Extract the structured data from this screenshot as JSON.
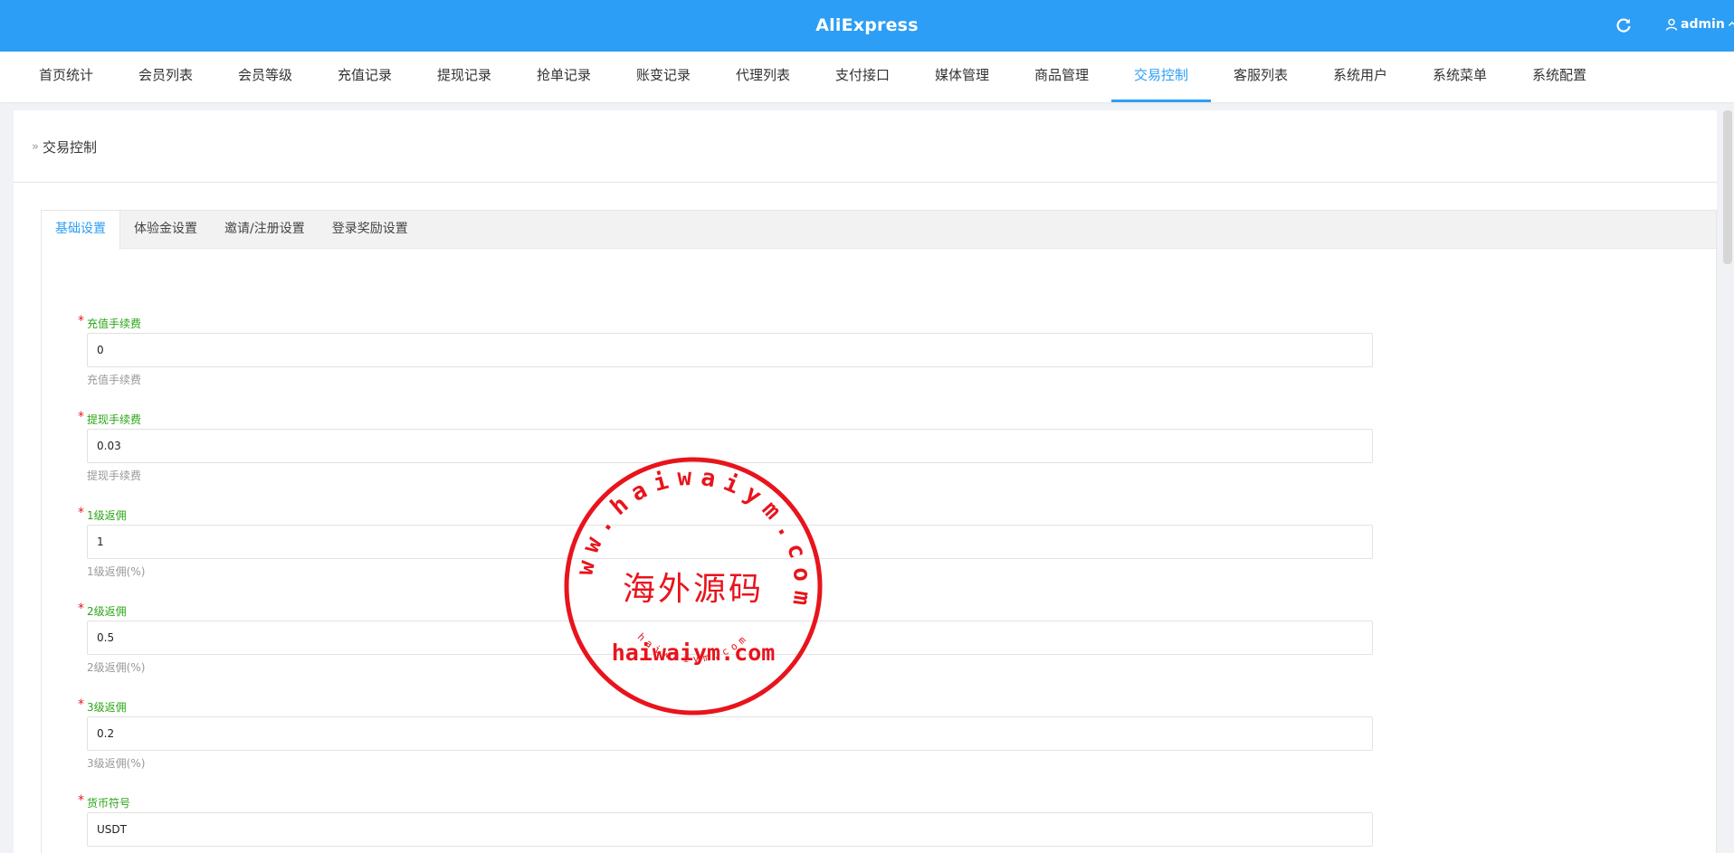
{
  "app": {
    "title": "AliExpress",
    "user": "admin",
    "accent_color": "#2d9ef5"
  },
  "nav": {
    "items": [
      {
        "label": "首页统计"
      },
      {
        "label": "会员列表"
      },
      {
        "label": "会员等级"
      },
      {
        "label": "充值记录"
      },
      {
        "label": "提现记录"
      },
      {
        "label": "抢单记录"
      },
      {
        "label": "账变记录"
      },
      {
        "label": "代理列表"
      },
      {
        "label": "支付接口"
      },
      {
        "label": "媒体管理"
      },
      {
        "label": "商品管理"
      },
      {
        "label": "交易控制",
        "active": true
      },
      {
        "label": "客服列表"
      },
      {
        "label": "系统用户"
      },
      {
        "label": "系统菜单"
      },
      {
        "label": "系统配置"
      }
    ]
  },
  "breadcrumb": {
    "chevron": "»",
    "current": "交易控制"
  },
  "tabs": [
    {
      "label": "基础设置",
      "active": true
    },
    {
      "label": "体验金设置"
    },
    {
      "label": "邀请/注册设置"
    },
    {
      "label": "登录奖励设置"
    }
  ],
  "form": {
    "required_mark": "*",
    "fields": [
      {
        "label": "充值手续费",
        "value": "0",
        "help": "充值手续费"
      },
      {
        "label": "提现手续费",
        "value": "0.03",
        "help": "提现手续费"
      },
      {
        "label": "1级返佣",
        "value": "1",
        "help": "1级返佣(%)"
      },
      {
        "label": "2级返佣",
        "value": "0.5",
        "help": "2级返佣(%)"
      },
      {
        "label": "3级返佣",
        "value": "0.2",
        "help": "3级返佣(%)"
      },
      {
        "label": "货币符号",
        "value": "USDT",
        "help": ""
      }
    ]
  },
  "watermark": {
    "ring_text": "www.haiwaiym.com",
    "center_text": "海外源码",
    "domain_text": "haiwaiym.com",
    "small_text": "haiwaiym.com",
    "color": "#e8141c"
  }
}
